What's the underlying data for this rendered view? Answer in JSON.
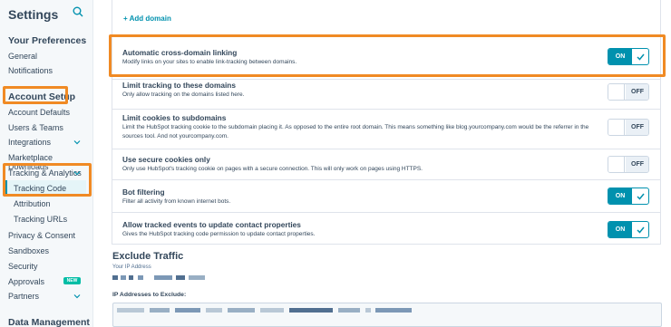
{
  "sidebar": {
    "title": "Settings",
    "sections": [
      {
        "label": "Your Preferences"
      },
      {
        "label": "Account Setup"
      },
      {
        "label": "Data Management"
      }
    ],
    "preferences": [
      "General",
      "Notifications"
    ],
    "account_items": [
      "Account Defaults",
      "Users & Teams",
      "Integrations",
      "Marketplace Downloads",
      "Tracking & Analytics",
      "Tracking Code",
      "Attribution",
      "Tracking URLs",
      "Privacy & Consent",
      "Sandboxes",
      "Security",
      "Approvals",
      "Partners"
    ],
    "approvals_badge": "NEW",
    "active_item": "Tracking Code"
  },
  "main": {
    "add_domain": "Add domain",
    "settings": [
      {
        "title": "Automatic cross-domain linking",
        "desc": "Modify links on your sites to enable link-tracking between domains.",
        "state": "ON"
      },
      {
        "title": "Limit tracking to these domains",
        "desc": "Only allow tracking on the domains listed here.",
        "state": "OFF"
      },
      {
        "title": "Limit cookies to subdomains",
        "desc": "Limit the HubSpot tracking cookie to the subdomain placing it. As opposed to the entire root domain. This means something like blog.yourcompany.com would be the referrer in the sources tool. And not yourcompany.com.",
        "state": "OFF"
      },
      {
        "title": "Use secure cookies only",
        "desc": "Only use HubSpot's tracking cookie on pages with a secure connection. This will only work on pages using HTTPS.",
        "state": "OFF"
      },
      {
        "title": "Bot filtering",
        "desc": "Filter all activity from known internet bots.",
        "state": "ON"
      },
      {
        "title": "Allow tracked events to update contact properties",
        "desc": "Gives the HubSpot tracking code permission to update contact properties.",
        "state": "ON"
      }
    ],
    "exclude": {
      "title": "Exclude Traffic",
      "ip_label": "Your IP Address",
      "ip_to_exclude_label": "IP Addresses to Exclude:"
    }
  },
  "colors": {
    "accent": "#0091ae",
    "highlight": "#f08a24",
    "text": "#33475b"
  }
}
